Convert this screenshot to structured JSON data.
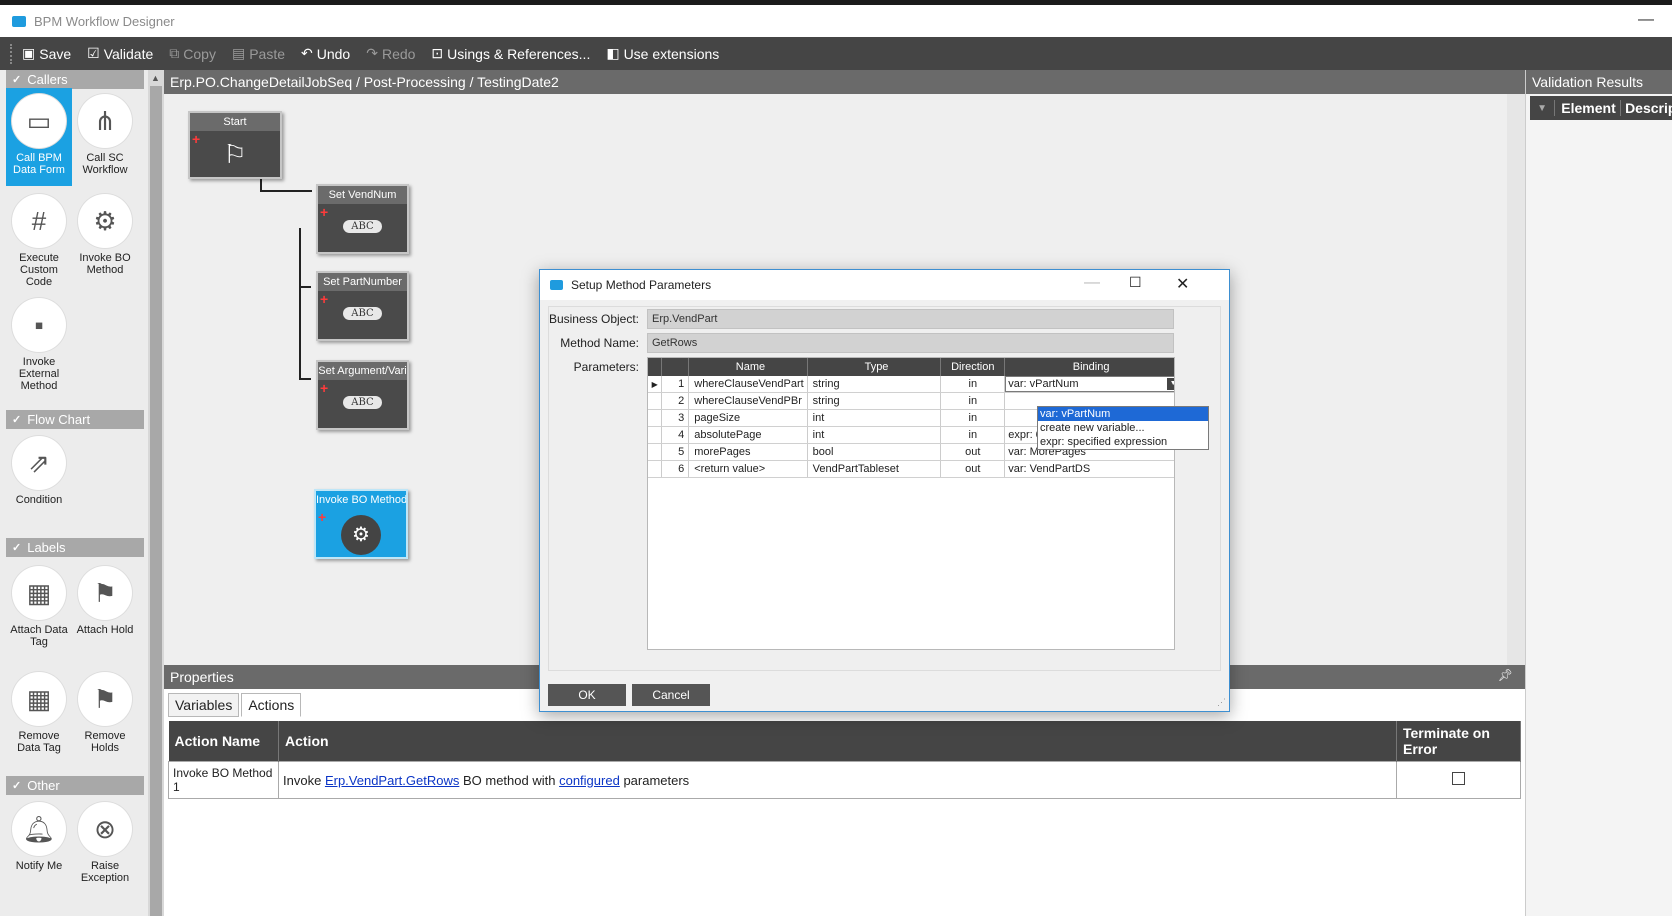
{
  "window": {
    "title": "BPM Workflow Designer",
    "minimize": "—"
  },
  "toolbar": {
    "save": "Save",
    "validate": "Validate",
    "copy": "Copy",
    "paste": "Paste",
    "undo": "Undo",
    "redo": "Redo",
    "usings": "Usings & References...",
    "extensions": "Use extensions"
  },
  "palette": {
    "callers_header": "Callers",
    "flowchart_header": "Flow Chart",
    "labels_header": "Labels",
    "other_header": "Other",
    "tools": {
      "call_bpm_data_form": "Call BPM Data Form",
      "call_sc_workflow": "Call SC Workflow",
      "execute_custom_code": "Execute Custom Code",
      "invoke_bo_method": "Invoke BO Method",
      "invoke_external_method": "Invoke External Method",
      "condition": "Condition",
      "attach_data_tag": "Attach Data Tag",
      "attach_hold": "Attach Hold",
      "remove_data_tag": "Remove Data Tag",
      "remove_holds": "Remove Holds",
      "notify_me": "Notify Me",
      "raise_exception": "Raise Exception"
    }
  },
  "breadcrumb": "Erp.PO.ChangeDetailJobSeq / Post-Processing / TestingDate2",
  "nodes": {
    "start": "Start",
    "set_vendnum": "Set VendNum",
    "set_partnumber": "Set PartNumber",
    "set_argument": "Set Argument/Vari",
    "invoke_bo": "Invoke BO Method",
    "abc": "ABC"
  },
  "validation": {
    "title": "Validation Results",
    "col_element": "Element",
    "col_description": "Descrip"
  },
  "properties": {
    "title": "Properties",
    "tabs": [
      "Variables",
      "Actions"
    ],
    "columns": [
      "Action Name",
      "Action",
      "Terminate on Error"
    ],
    "row": {
      "action_name": "Invoke BO Method 1",
      "prefix": "Invoke",
      "link1": "Erp.VendPart.GetRows",
      "middle": "BO method with",
      "link2": "configured",
      "suffix": "parameters"
    }
  },
  "dialog": {
    "title": "Setup Method Parameters",
    "business_object_label": "Business Object:",
    "business_object": "Erp.VendPart",
    "method_name_label": "Method Name:",
    "method_name": "GetRows",
    "parameters_label": "Parameters:",
    "columns": [
      "Name",
      "Type",
      "Direction",
      "Binding"
    ],
    "rows": [
      {
        "num": "1",
        "name": "whereClauseVendPart",
        "type": "string",
        "dir": "in",
        "binding": "var: vPartNum"
      },
      {
        "num": "2",
        "name": "whereClauseVendPBr",
        "type": "string",
        "dir": "in",
        "binding": ""
      },
      {
        "num": "3",
        "name": "pageSize",
        "type": "int",
        "dir": "in",
        "binding": ""
      },
      {
        "num": "4",
        "name": "absolutePage",
        "type": "int",
        "dir": "in",
        "binding": "expr: 0"
      },
      {
        "num": "5",
        "name": "morePages",
        "type": "bool",
        "dir": "out",
        "binding": "var: MorePages"
      },
      {
        "num": "6",
        "name": "<return value>",
        "type": "VendPartTableset",
        "dir": "out",
        "binding": "var: VendPartDS"
      }
    ],
    "dropdown_options": [
      "var: vPartNum",
      "create new variable...",
      "expr: specified expression"
    ],
    "ok": "OK",
    "cancel": "Cancel"
  }
}
